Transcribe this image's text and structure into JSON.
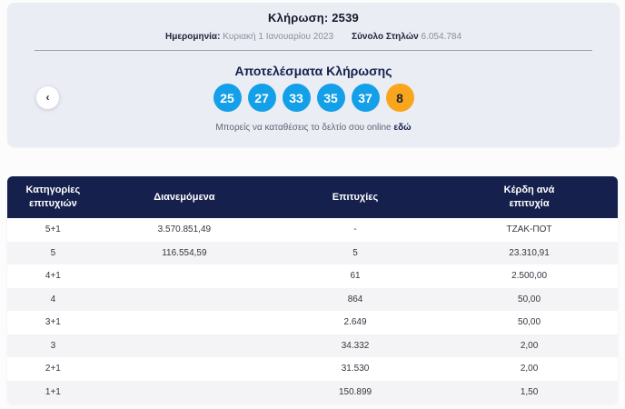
{
  "header": {
    "draw_title": "Κλήρωση: 2539",
    "date_label": "Ημερομηνία:",
    "date_value": "Κυριακή 1 Ιανουαρίου 2023",
    "columns_label": "Σύνολο Στηλών",
    "columns_value": "6.054.784"
  },
  "results": {
    "title": "Αποτελέσματα Κλήρωσης",
    "numbers": [
      "25",
      "27",
      "33",
      "35",
      "37"
    ],
    "bonus_number": "8",
    "note_text": "Μπορείς να καταθέσεις το δελτίο σου online",
    "note_link": "εδώ",
    "prev_arrow": "‹"
  },
  "table": {
    "headers": [
      "Κατηγορίες επιτυχιών",
      "Διανεμόμενα",
      "Επιτυχίες",
      "Κέρδη ανά επιτυχία"
    ],
    "rows": [
      [
        "5+1",
        "3.570.851,49",
        "-",
        "ΤΖΑΚ-ΠΟΤ"
      ],
      [
        "5",
        "116.554,59",
        "5",
        "23.310,91"
      ],
      [
        "4+1",
        "",
        "61",
        "2.500,00"
      ],
      [
        "4",
        "",
        "864",
        "50,00"
      ],
      [
        "3+1",
        "",
        "2.649",
        "50,00"
      ],
      [
        "3",
        "",
        "34.332",
        "2,00"
      ],
      [
        "2+1",
        "",
        "31.530",
        "2,00"
      ],
      [
        "1+1",
        "",
        "150.899",
        "1,50"
      ]
    ]
  },
  "colors": {
    "ball_blue": "#149fe9",
    "ball_orange": "#f9a51d",
    "header_navy": "#15204d",
    "panel_bg": "#eaedf4",
    "row_alt": "#f4f4f6"
  }
}
